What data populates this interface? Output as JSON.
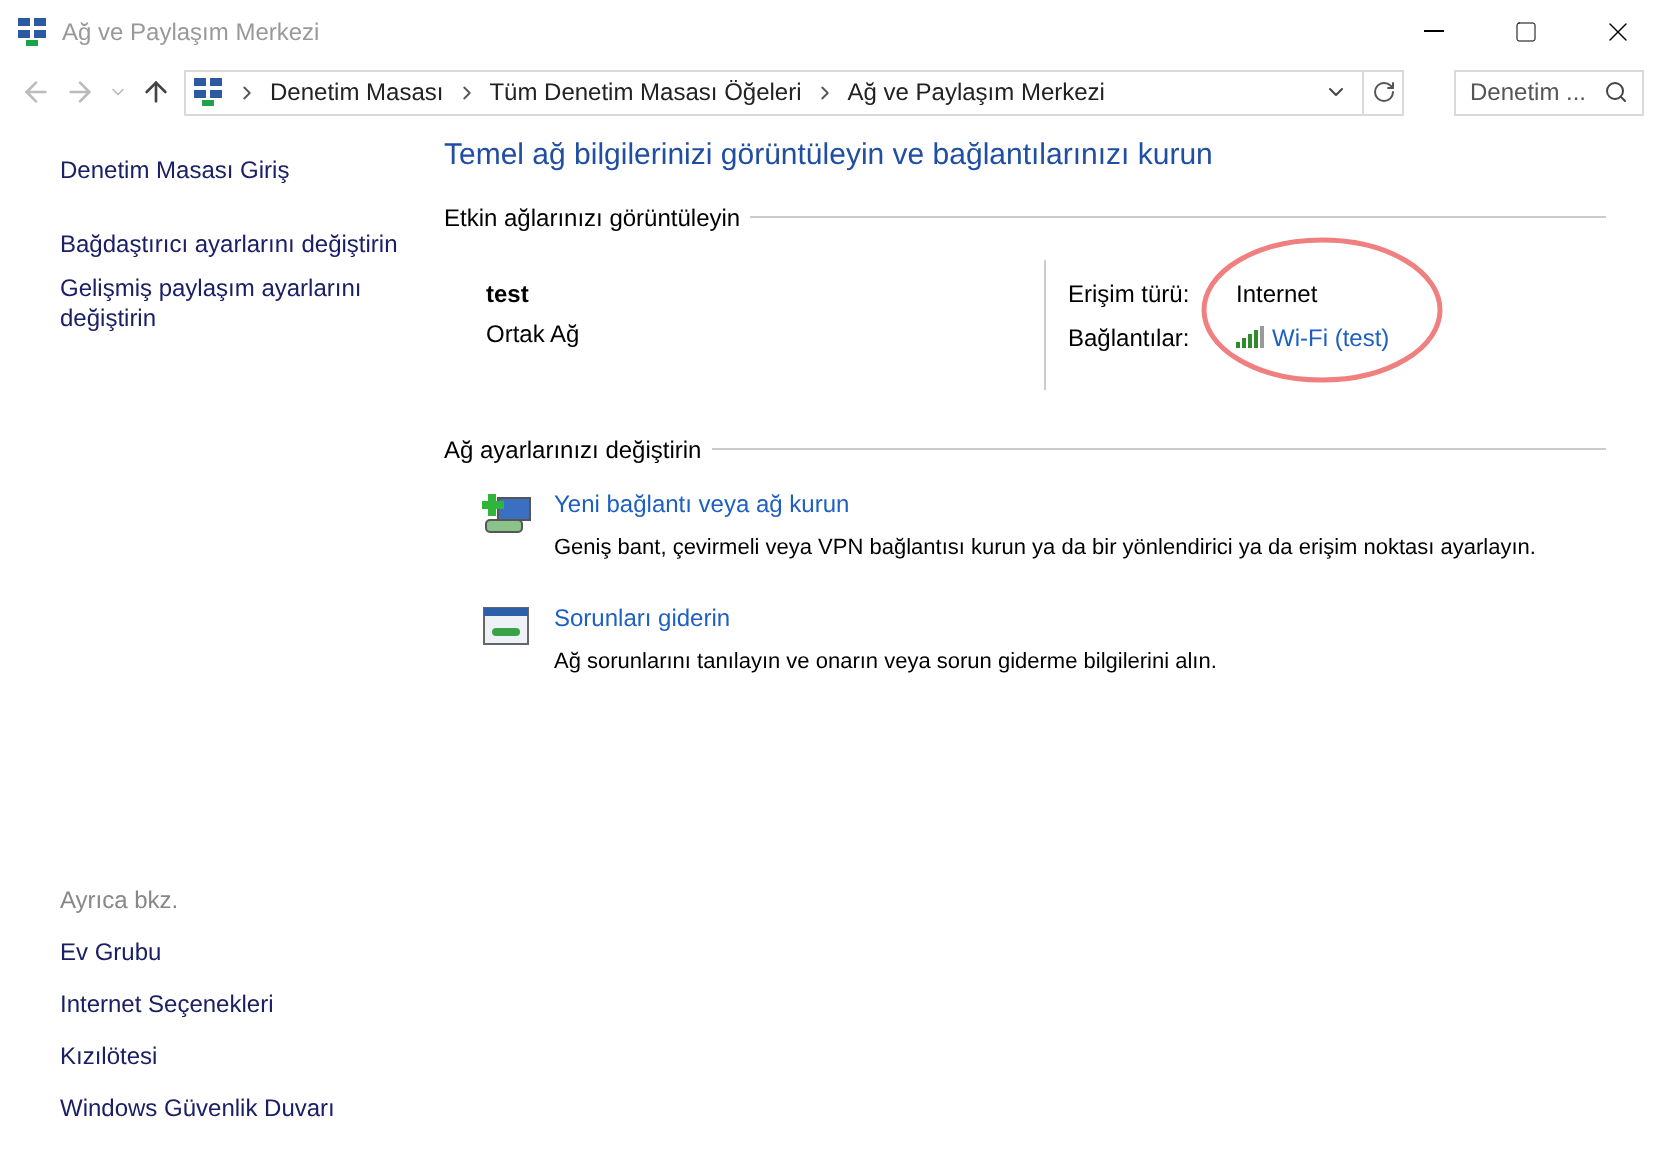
{
  "window": {
    "title": "Ağ ve Paylaşım Merkezi"
  },
  "address_bar": {
    "breadcrumbs": [
      "Denetim Masası",
      "Tüm Denetim Masası Öğeleri",
      "Ağ ve Paylaşım Merkezi"
    ],
    "search_placeholder": "Denetim ..."
  },
  "sidebar": {
    "items": [
      "Denetim Masası Giriş",
      "Bağdaştırıcı ayarlarını değiştirin",
      "Gelişmiş paylaşım ayarlarını değiştirin"
    ],
    "see_also": {
      "heading": "Ayrıca bkz.",
      "items": [
        "Ev Grubu",
        "Internet Seçenekleri",
        "Kızılötesi",
        "Windows Güvenlik Duvarı"
      ]
    }
  },
  "main": {
    "heading": "Temel ağ bilgilerinizi görüntüleyin ve bağlantılarınızı kurun",
    "active_networks": {
      "heading": "Etkin ağlarınızı görüntüleyin",
      "network_name": "test",
      "network_type": "Ortak Ağ",
      "access_type_label": "Erişim türü:",
      "access_type": "Internet",
      "connections_label": "Bağlantılar:",
      "connection": "Wi-Fi (test)"
    },
    "change_settings": {
      "heading": "Ağ ayarlarınızı değiştirin",
      "tasks": [
        {
          "kind": "new-connection",
          "title": "Yeni bağlantı veya ağ kurun",
          "description": "Geniş bant, çevirmeli veya VPN bağlantısı kurun ya da bir yönlendirici ya da erişim noktası ayarlayın."
        },
        {
          "kind": "troubleshoot",
          "title": "Sorunları giderin",
          "description": "Ağ sorunlarını tanılayın ve onarın veya sorun giderme bilgilerini alın."
        }
      ]
    }
  }
}
